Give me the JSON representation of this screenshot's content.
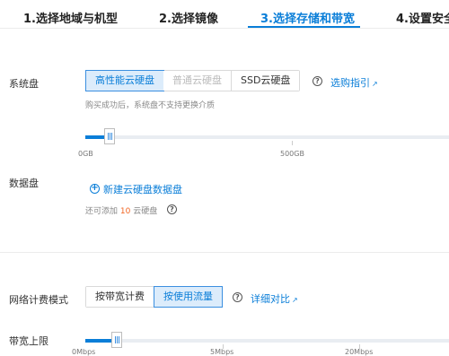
{
  "steps": [
    {
      "label": "1.选择地域与机型"
    },
    {
      "label": "2.选择镜像"
    },
    {
      "label": "3.选择存储和带宽"
    },
    {
      "label": "4.设置安全"
    }
  ],
  "system_disk": {
    "label": "系统盘",
    "options": [
      "高性能云硬盘",
      "普通云硬盘",
      "SSD云硬盘"
    ],
    "selected": "高性能云硬盘",
    "guide_link": "选购指引",
    "hint": "购买成功后，系统盘不支持更换介质",
    "slider": {
      "min_label": "0GB",
      "mid_label": "500GB",
      "value_fraction": 0.05
    }
  },
  "data_disk": {
    "label": "数据盘",
    "add_link": "新建云硬盘数据盘",
    "hint_prefix": "还可添加",
    "hint_count": "10",
    "hint_suffix": "云硬盘"
  },
  "network": {
    "label": "网络计费模式",
    "options": [
      "按带宽计费",
      "按使用流量"
    ],
    "selected": "按使用流量",
    "compare_link": "详细对比"
  },
  "bandwidth": {
    "label": "带宽上限",
    "scale": [
      "0Mbps",
      "5Mbps",
      "20Mbps"
    ],
    "value_fraction": 0.09
  },
  "colors": {
    "accent": "#0a7ed8",
    "count": "#f26522"
  }
}
